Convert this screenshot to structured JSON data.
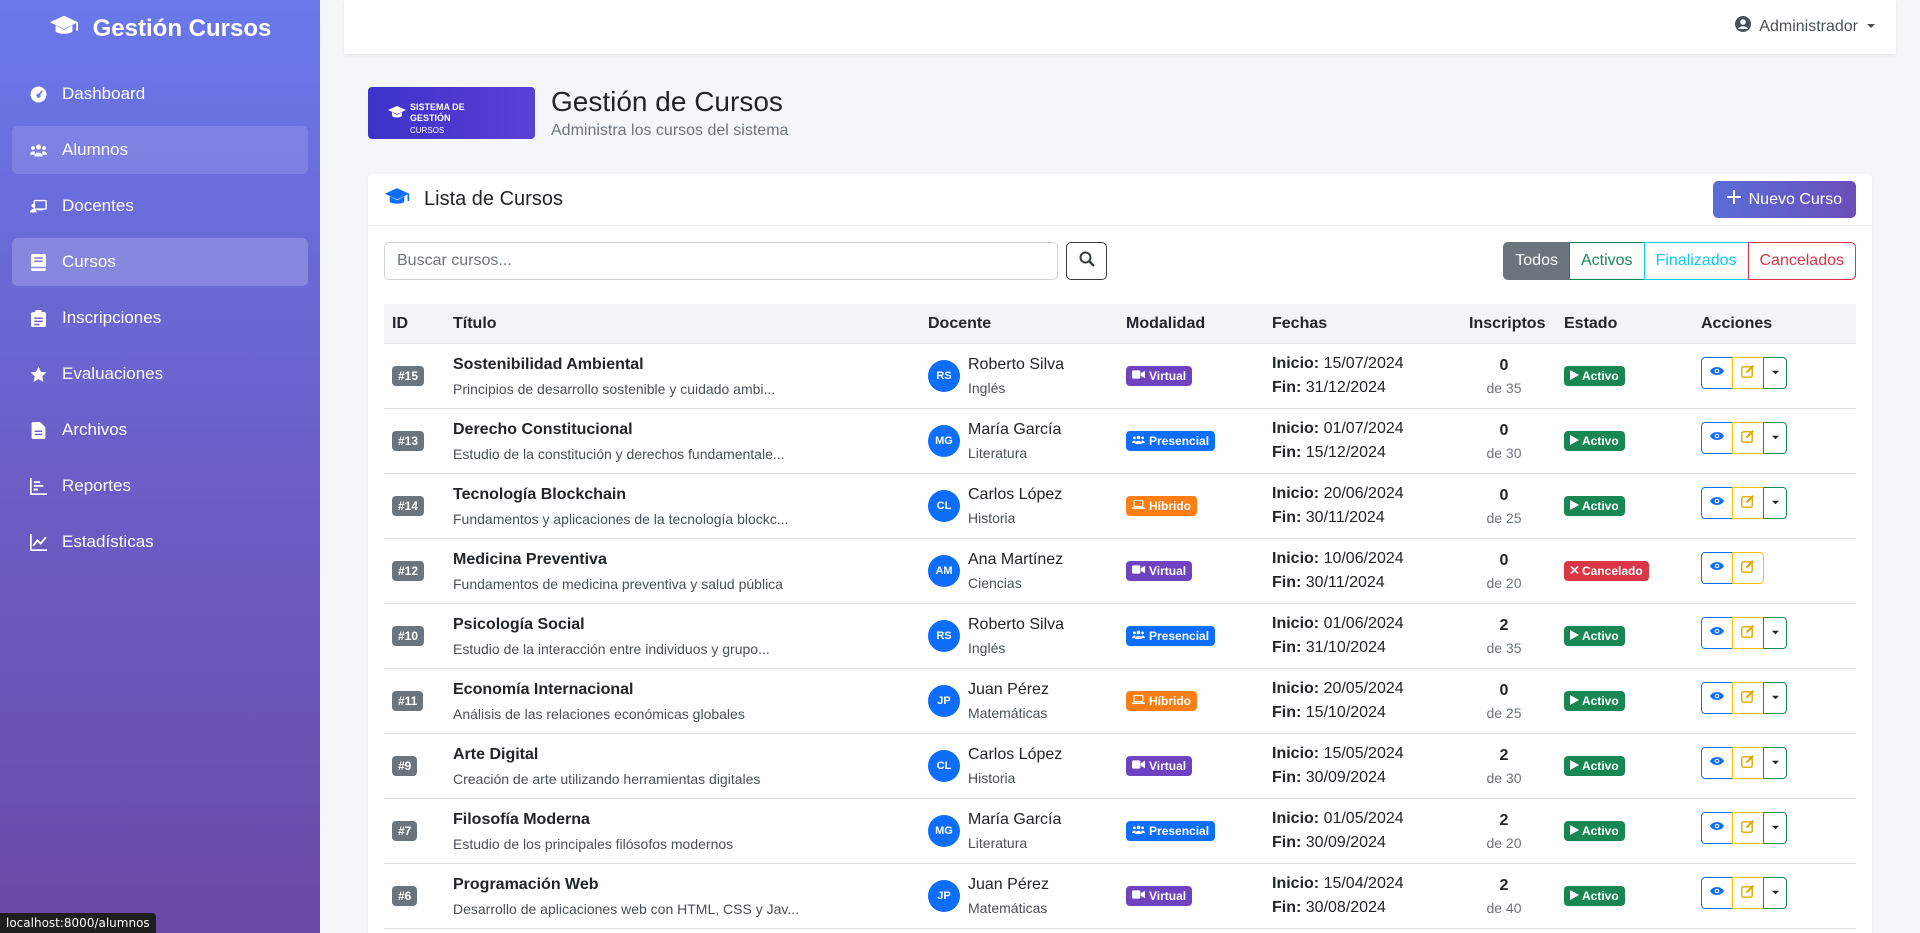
{
  "sidebar": {
    "brand": "Gestión Cursos",
    "items": [
      {
        "label": "Dashboard",
        "icon": "dashboard-icon"
      },
      {
        "label": "Alumnos",
        "icon": "users-icon"
      },
      {
        "label": "Docentes",
        "icon": "teacher-icon"
      },
      {
        "label": "Cursos",
        "icon": "book-icon"
      },
      {
        "label": "Inscripciones",
        "icon": "clipboard-icon"
      },
      {
        "label": "Evaluaciones",
        "icon": "star-icon"
      },
      {
        "label": "Archivos",
        "icon": "file-icon"
      },
      {
        "label": "Reportes",
        "icon": "report-icon"
      },
      {
        "label": "Estadísticas",
        "icon": "chart-icon"
      }
    ]
  },
  "topbar": {
    "user": "Administrador"
  },
  "header": {
    "logo_line1": "SISTEMA DE GESTIÓN",
    "logo_line2": "CURSOS",
    "title": "Gestión de Cursos",
    "subtitle": "Administra los cursos del sistema"
  },
  "card": {
    "title": "Lista de Cursos",
    "new_button": "Nuevo Curso",
    "search_placeholder": "Buscar cursos...",
    "filters": [
      "Todos",
      "Activos",
      "Finalizados",
      "Cancelados"
    ]
  },
  "table": {
    "headers": [
      "ID",
      "Título",
      "Docente",
      "Modalidad",
      "Fechas",
      "Inscriptos",
      "Estado",
      "Acciones"
    ],
    "start_label": "Inicio:",
    "end_label": "Fin:",
    "rows": [
      {
        "id": "#15",
        "title": "Sostenibilidad Ambiental",
        "desc": "Principios de desarrollo sostenible y cuidado ambi...",
        "initials": "RS",
        "teacher": "Roberto Silva",
        "subject": "Inglés",
        "mode": "Virtual",
        "start": "15/07/2024",
        "end": "31/12/2024",
        "enrolled": "0",
        "capacity": "de 35",
        "status": "Activo"
      },
      {
        "id": "#13",
        "title": "Derecho Constitucional",
        "desc": "Estudio de la constitución y derechos fundamentale...",
        "initials": "MG",
        "teacher": "María García",
        "subject": "Literatura",
        "mode": "Presencial",
        "start": "01/07/2024",
        "end": "15/12/2024",
        "enrolled": "0",
        "capacity": "de 30",
        "status": "Activo"
      },
      {
        "id": "#14",
        "title": "Tecnología Blockchain",
        "desc": "Fundamentos y aplicaciones de la tecnología blockc...",
        "initials": "CL",
        "teacher": "Carlos López",
        "subject": "Historia",
        "mode": "Híbrido",
        "start": "20/06/2024",
        "end": "30/11/2024",
        "enrolled": "0",
        "capacity": "de 25",
        "status": "Activo"
      },
      {
        "id": "#12",
        "title": "Medicina Preventiva",
        "desc": "Fundamentos de medicina preventiva y salud pública",
        "initials": "AM",
        "teacher": "Ana Martínez",
        "subject": "Ciencias",
        "mode": "Virtual",
        "start": "10/06/2024",
        "end": "30/11/2024",
        "enrolled": "0",
        "capacity": "de 20",
        "status": "Cancelado"
      },
      {
        "id": "#10",
        "title": "Psicología Social",
        "desc": "Estudio de la interacción entre individuos y grupo...",
        "initials": "RS",
        "teacher": "Roberto Silva",
        "subject": "Inglés",
        "mode": "Presencial",
        "start": "01/06/2024",
        "end": "31/10/2024",
        "enrolled": "2",
        "capacity": "de 35",
        "status": "Activo"
      },
      {
        "id": "#11",
        "title": "Economía Internacional",
        "desc": "Análisis de las relaciones económicas globales",
        "initials": "JP",
        "teacher": "Juan Pérez",
        "subject": "Matemáticas",
        "mode": "Híbrido",
        "start": "20/05/2024",
        "end": "15/10/2024",
        "enrolled": "0",
        "capacity": "de 25",
        "status": "Activo"
      },
      {
        "id": "#9",
        "title": "Arte Digital",
        "desc": "Creación de arte utilizando herramientas digitales",
        "initials": "CL",
        "teacher": "Carlos López",
        "subject": "Historia",
        "mode": "Virtual",
        "start": "15/05/2024",
        "end": "30/09/2024",
        "enrolled": "2",
        "capacity": "de 30",
        "status": "Activo"
      },
      {
        "id": "#7",
        "title": "Filosofía Moderna",
        "desc": "Estudio de los principales filósofos modernos",
        "initials": "MG",
        "teacher": "María García",
        "subject": "Literatura",
        "mode": "Presencial",
        "start": "01/05/2024",
        "end": "30/09/2024",
        "enrolled": "2",
        "capacity": "de 20",
        "status": "Activo"
      },
      {
        "id": "#6",
        "title": "Programación Web",
        "desc": "Desarrollo de aplicaciones web con HTML, CSS y Jav...",
        "initials": "JP",
        "teacher": "Juan Pérez",
        "subject": "Matemáticas",
        "mode": "Virtual",
        "start": "15/04/2024",
        "end": "30/08/2024",
        "enrolled": "2",
        "capacity": "de 40",
        "status": "Activo"
      }
    ]
  },
  "colors": {
    "virtual": "#6f42c1",
    "presencial": "#0d6efd",
    "hibrido": "#fd7e14",
    "activo": "#198754",
    "cancelado": "#dc3545"
  },
  "status_bar": {
    "url": "localhost:8000/alumnos"
  }
}
